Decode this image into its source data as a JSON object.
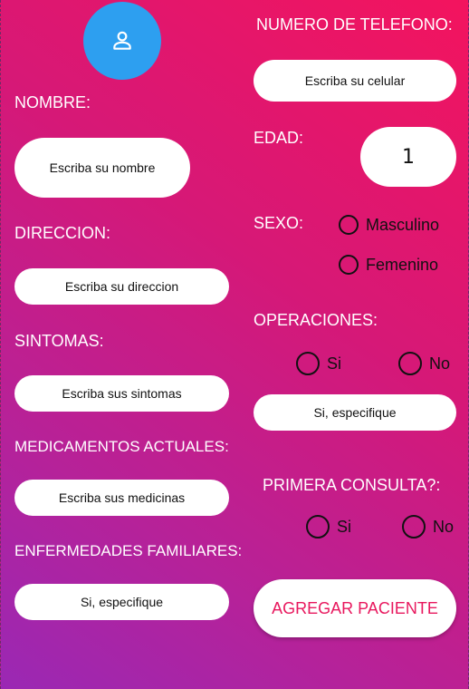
{
  "form": {
    "nombre_label": "NOMBRE:",
    "nombre_placeholder": "Escriba su nombre",
    "direccion_label": "DIRECCION:",
    "direccion_placeholder": "Escriba su direccion",
    "sintomas_label": "SINTOMAS:",
    "sintomas_placeholder": "Escriba sus sintomas",
    "medicamentos_label": "MEDICAMENTOS ACTUALES:",
    "medicamentos_placeholder": "Escriba sus medicinas",
    "enfermedades_label": "ENFERMEDADES FAMILIARES:",
    "enfermedades_placeholder": "Si, especifique",
    "telefono_label": "NUMERO DE TELEFONO:",
    "telefono_placeholder": "Escriba su celular",
    "edad_label": "EDAD:",
    "edad_value": "1",
    "sexo_label": "SEXO:",
    "sexo_options": [
      "Masculino",
      "Femenino"
    ],
    "operaciones_label": "OPERACIONES:",
    "operaciones_options": [
      "Si",
      "No"
    ],
    "operaciones_placeholder": "Si, especifique",
    "primera_label": "PRIMERA CONSULTA?:",
    "primera_options": [
      "Si",
      "No"
    ],
    "agregar_button": "AGREGAR PACIENTE"
  },
  "icons": {
    "avatar": "person-icon"
  },
  "colors": {
    "gradient_top": "#f3145e",
    "gradient_bottom": "#9a28b4",
    "avatar_bg": "#2d9ff0",
    "button_text": "#e8185e"
  }
}
